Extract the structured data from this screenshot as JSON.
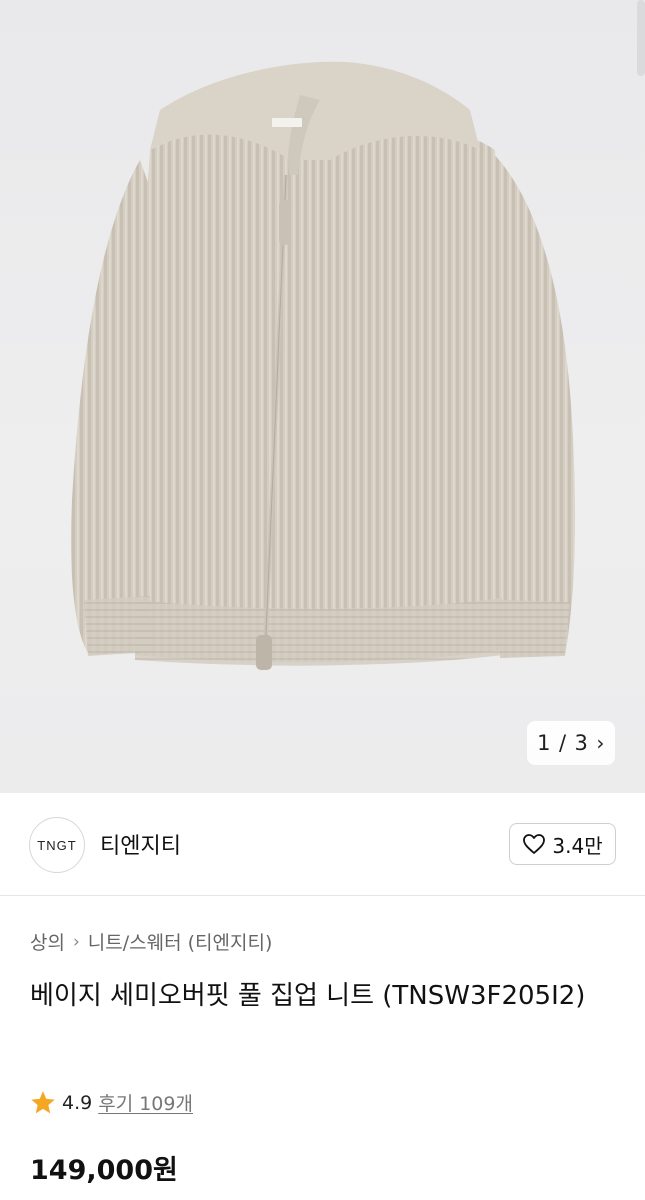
{
  "gallery": {
    "current": "1",
    "separator": "/",
    "total": "3",
    "next_icon": "chevron-right-icon",
    "image_subject": "beige knit full zip-up sweater"
  },
  "brand": {
    "logo_text": "TNGT",
    "name": "티엔지티",
    "like_icon": "heart-outline-icon",
    "like_count": "3.4만"
  },
  "breadcrumb": {
    "items": [
      "상의",
      "니트/스웨터 (티엔지티)"
    ],
    "separator_icon": "chevron-right-icon"
  },
  "product": {
    "title": "베이지 세미오버핏 풀 집업 니트 (TNSW3F205I2)",
    "rating": "4.9",
    "rating_icon": "star-icon",
    "reviews": "후기 109개",
    "price": "149,000원"
  },
  "colors": {
    "star": "#f5a623",
    "sweater": "#d6cfc3",
    "background": "#ebebec"
  }
}
